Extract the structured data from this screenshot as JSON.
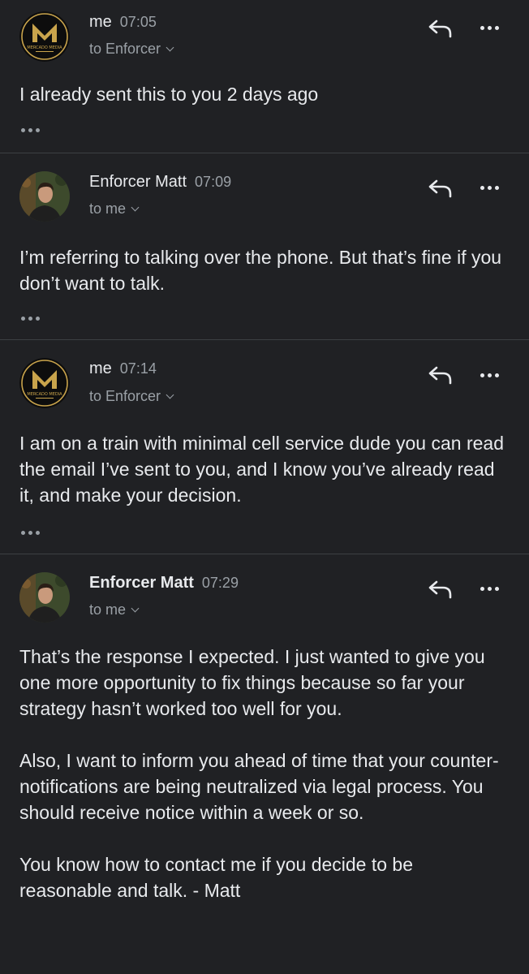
{
  "messages": [
    {
      "sender": "me",
      "time": "07:05",
      "recipient": "to Enforcer",
      "avatar": "mercado-media-logo",
      "avatar_text": "MERCADO MEDIA",
      "body": [
        "I already sent this to you 2 days ago"
      ]
    },
    {
      "sender": "Enforcer Matt",
      "time": "07:09",
      "recipient": "to me",
      "avatar": "person-photo",
      "body": [
        "I’m referring to talking over the phone. But that’s fine if you don’t want to talk."
      ]
    },
    {
      "sender": "me",
      "time": "07:14",
      "recipient": "to Enforcer",
      "avatar": "mercado-media-logo",
      "avatar_text": "MERCADO MEDIA",
      "body": [
        "I am on a train with minimal cell service dude you can read the email I’ve sent to you, and I know you’ve already read it, and make your decision."
      ]
    },
    {
      "sender": "Enforcer Matt",
      "time": "07:29",
      "recipient": "to me",
      "avatar": "person-photo",
      "body": [
        "That’s the response I expected. I just wanted to give you one more opportunity to fix things because so far your strategy hasn’t worked too well for you.",
        "Also, I want to inform you ahead of time that your counter-notifications are being neutralized via legal process. You should receive notice within a week or so.",
        "You know how to contact me if you decide to be reasonable and talk. - Matt"
      ]
    }
  ],
  "icons": {
    "reply": "reply-arrow-icon",
    "more": "more-horizontal-icon",
    "trimmed": "trimmed-content-icon",
    "recipient_toggle": "chevron-down-icon"
  },
  "colors": {
    "background": "#202124",
    "text": "#e8eaed",
    "secondary_text": "#9aa0a6",
    "divider": "#3c4043",
    "logo_gold": "#c9a44c"
  }
}
